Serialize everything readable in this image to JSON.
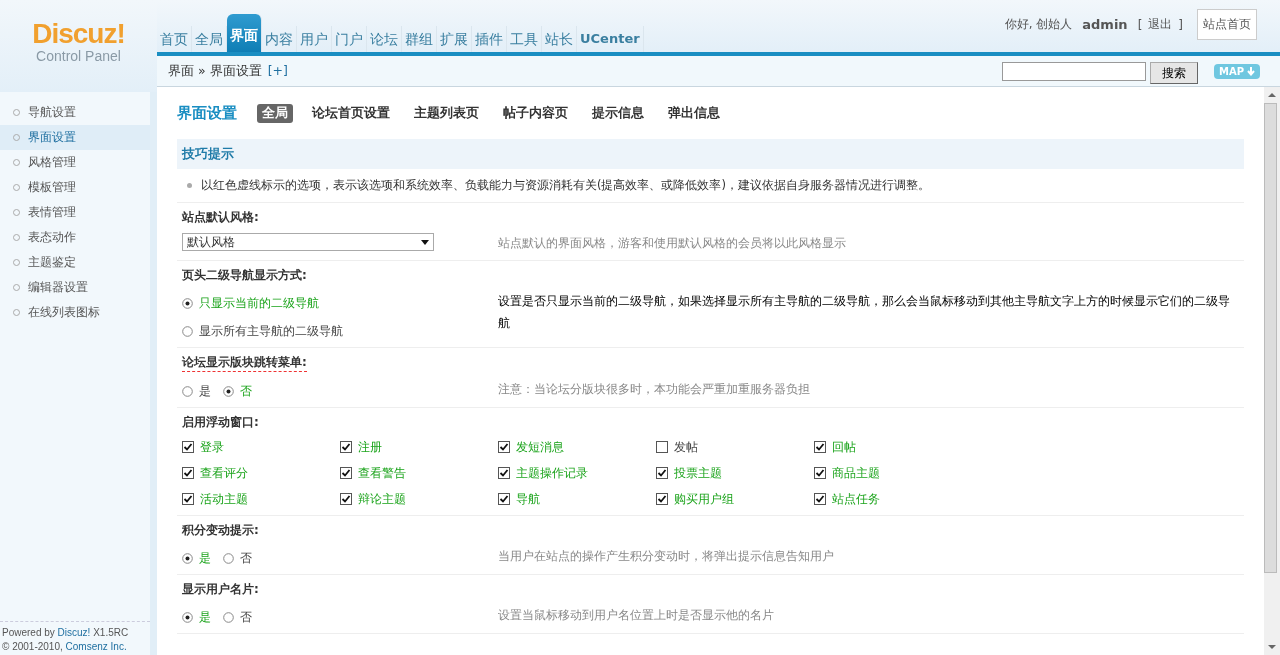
{
  "logo": {
    "name": "Discuz!",
    "subtitle": "Control Panel"
  },
  "top_nav": [
    {
      "label": "首页",
      "selected": false
    },
    {
      "label": "全局",
      "selected": false
    },
    {
      "label": "界面",
      "selected": true
    },
    {
      "label": "内容",
      "selected": false
    },
    {
      "label": "用户",
      "selected": false
    },
    {
      "label": "门户",
      "selected": false
    },
    {
      "label": "论坛",
      "selected": false
    },
    {
      "label": "群组",
      "selected": false
    },
    {
      "label": "扩展",
      "selected": false
    },
    {
      "label": "插件",
      "selected": false
    },
    {
      "label": "工具",
      "selected": false
    },
    {
      "label": "站长",
      "selected": false
    },
    {
      "label": "UCenter",
      "selected": false
    }
  ],
  "user_bar": {
    "greeting": "你好, 创始人",
    "user": "admin",
    "open_bracket": "[",
    "logout": "退出",
    "close_bracket": "]",
    "site_home": "站点首页"
  },
  "breadcrumb": {
    "path": [
      "界面",
      "界面设置"
    ],
    "separator": "»",
    "add": "[+]"
  },
  "search": {
    "button": "搜索"
  },
  "map_button": "MAP",
  "sidebar": {
    "items": [
      {
        "label": "导航设置",
        "selected": false
      },
      {
        "label": "界面设置",
        "selected": true
      },
      {
        "label": "风格管理",
        "selected": false
      },
      {
        "label": "模板管理",
        "selected": false
      },
      {
        "label": "表情管理",
        "selected": false
      },
      {
        "label": "表态动作",
        "selected": false
      },
      {
        "label": "主题鉴定",
        "selected": false
      },
      {
        "label": "编辑器设置",
        "selected": false
      },
      {
        "label": "在线列表图标",
        "selected": false
      }
    ],
    "footer": {
      "powered": "Powered by",
      "product": "Discuz!",
      "version": "X1.5RC",
      "copyright": "© 2001-2010,",
      "company": "Comsenz Inc."
    }
  },
  "page": {
    "title": "界面设置",
    "tabs": [
      {
        "label": "全局",
        "selected": true
      },
      {
        "label": "论坛首页设置",
        "selected": false
      },
      {
        "label": "主题列表页",
        "selected": false
      },
      {
        "label": "帖子内容页",
        "selected": false
      },
      {
        "label": "提示信息",
        "selected": false
      },
      {
        "label": "弹出信息",
        "selected": false
      }
    ]
  },
  "tips": {
    "title": "技巧提示",
    "items": [
      "以红色虚线标示的选项，表示该选项和系统效率、负载能力与资源消耗有关(提高效率、或降低效率)，建议依据自身服务器情况进行调整。"
    ]
  },
  "settings": [
    {
      "kind": "select",
      "label": "站点默认风格:",
      "performance_hint": false,
      "value": "默认风格",
      "description": "站点默认的界面风格，游客和使用默认风格的会员将以此风格显示"
    },
    {
      "kind": "radio",
      "label": "页头二级导航显示方式:",
      "performance_hint": false,
      "stacked": true,
      "options": [
        {
          "label": "只显示当前的二级导航",
          "selected": true
        },
        {
          "label": "显示所有主导航的二级导航",
          "selected": false
        }
      ],
      "description": "设置是否只显示当前的二级导航，如果选择显示所有主导航的二级导航，那么会当鼠标移动到其他主导航文字上方的时候显示它们的二级导航"
    },
    {
      "kind": "radio",
      "label": "论坛显示版块跳转菜单:",
      "performance_hint": true,
      "stacked": false,
      "options": [
        {
          "label": "是",
          "selected": false
        },
        {
          "label": "否",
          "selected": true
        }
      ],
      "description": "注意：当论坛分版块很多时，本功能会严重加重服务器负担"
    },
    {
      "kind": "checkboxes",
      "label": "启用浮动窗口:",
      "performance_hint": false,
      "options": [
        {
          "label": "登录",
          "checked": true
        },
        {
          "label": "注册",
          "checked": true
        },
        {
          "label": "发短消息",
          "checked": true
        },
        {
          "label": "发帖",
          "checked": false
        },
        {
          "label": "回帖",
          "checked": true
        },
        {
          "label": "查看评分",
          "checked": true
        },
        {
          "label": "查看警告",
          "checked": true
        },
        {
          "label": "主题操作记录",
          "checked": true
        },
        {
          "label": "投票主题",
          "checked": true
        },
        {
          "label": "商品主题",
          "checked": true
        },
        {
          "label": "活动主题",
          "checked": true
        },
        {
          "label": "辩论主题",
          "checked": true
        },
        {
          "label": "导航",
          "checked": true
        },
        {
          "label": "购买用户组",
          "checked": true
        },
        {
          "label": "站点任务",
          "checked": true
        }
      ]
    },
    {
      "kind": "radio",
      "label": "积分变动提示:",
      "performance_hint": false,
      "stacked": false,
      "options": [
        {
          "label": "是",
          "selected": true
        },
        {
          "label": "否",
          "selected": false
        }
      ],
      "description": "当用户在站点的操作产生积分变动时，将弹出提示信息告知用户"
    },
    {
      "kind": "radio",
      "label": "显示用户名片:",
      "performance_hint": false,
      "stacked": false,
      "options": [
        {
          "label": "是",
          "selected": true
        },
        {
          "label": "否",
          "selected": false
        }
      ],
      "description": "设置当鼠标移动到用户名位置上时是否显示他的名片"
    }
  ]
}
